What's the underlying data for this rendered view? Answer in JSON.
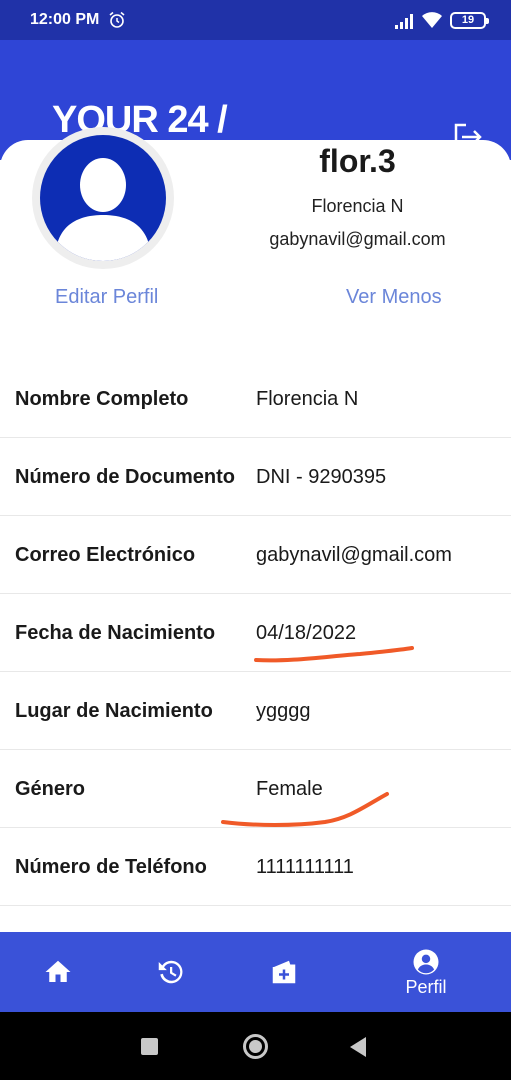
{
  "status_bar": {
    "time": "12:00 PM",
    "battery": "19"
  },
  "header": {
    "brand": "YOUR 24 /"
  },
  "profile": {
    "username": "flor.3",
    "full_name": "Florencia N",
    "email": "gabynavil@gmail.com",
    "edit_link": "Editar Perfil",
    "less_link": "Ver Menos"
  },
  "info": [
    {
      "label": "Nombre Completo",
      "value": "Florencia N"
    },
    {
      "label": "Número de Documento",
      "value": "DNI - 9290395"
    },
    {
      "label": "Correo Electrónico",
      "value": "gabynavil@gmail.com"
    },
    {
      "label": "Fecha de Nacimiento",
      "value": "04/18/2022"
    },
    {
      "label": "Lugar de Nacimiento",
      "value": "ygggg"
    },
    {
      "label": "Género",
      "value": "Female"
    },
    {
      "label": "Número de Teléfono",
      "value": "1111111111"
    }
  ],
  "bottom_nav": {
    "items": [
      {
        "icon": "home-icon"
      },
      {
        "icon": "history-icon"
      },
      {
        "icon": "medical-kit-icon"
      },
      {
        "icon": "account-circle-icon",
        "label": "Perfil"
      }
    ]
  },
  "colors": {
    "header_bg": "#2f45d6",
    "status_bar_bg": "#2032a8",
    "nav_bg": "#3a52d8",
    "link": "#6b86d9",
    "avatar_bg": "#0d2db4",
    "annotation": "#f05a28"
  }
}
